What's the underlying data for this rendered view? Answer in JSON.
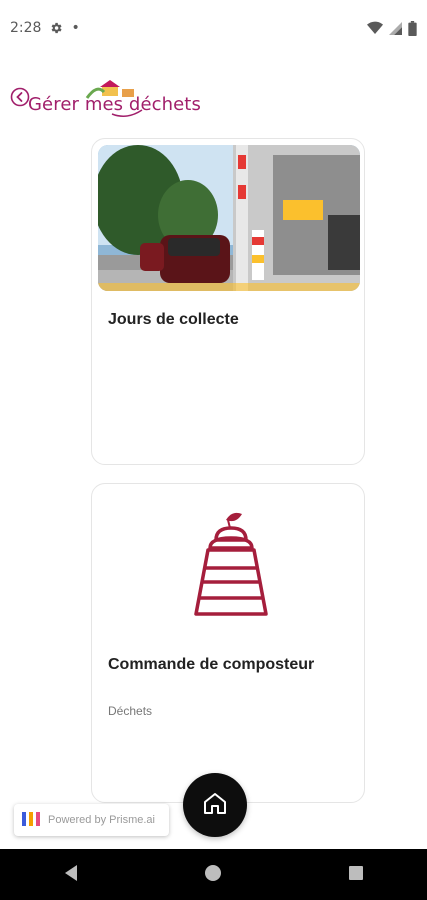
{
  "status_bar": {
    "time": "2:28",
    "dot": "•"
  },
  "header": {
    "title": "Gérer mes déchets"
  },
  "cards": [
    {
      "title": "Jours de collecte",
      "image": "garbage-truck-street-photo"
    },
    {
      "title": "Commande de composteur",
      "subtitle": "Déchets",
      "icon": "composter-icon"
    }
  ],
  "powered_by": {
    "label": "Powered by Prisme.ai"
  },
  "colors": {
    "accent": "#a11f6b",
    "fab": "#0d0d0d",
    "nav_bar": "#000000"
  }
}
